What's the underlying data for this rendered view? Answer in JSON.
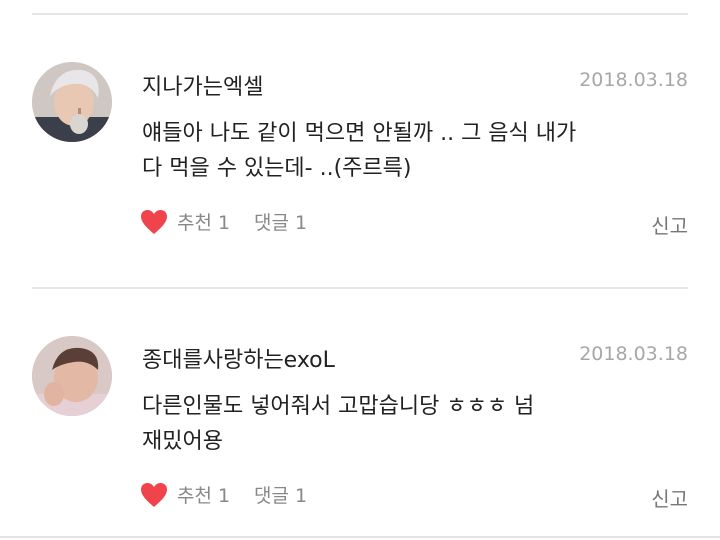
{
  "comments": [
    {
      "username": "지나가는엑셀",
      "date": "2018.03.18",
      "body_lines": [
        "얘들아 나도 같이 먹으면 안될까 .. 그 음식 내가",
        "다 먹을 수 있는데- ..(주르륵)"
      ],
      "like_label": "추천 1",
      "reply_label": "댓글 1",
      "report_label": "신고"
    },
    {
      "username": "종대를사랑하는exoL",
      "date": "2018.03.18",
      "body_lines": [
        "다른인물도 넣어줘서 고맙습니당  ㅎㅎㅎ 넘",
        "재밌어용"
      ],
      "like_label": "추천 1",
      "reply_label": "댓글 1",
      "report_label": "신고"
    }
  ],
  "colors": {
    "heart": "#f0434b",
    "text": "#222222",
    "muted": "#888888",
    "date": "#a7a7a7",
    "divider": "#e6e6e6"
  }
}
